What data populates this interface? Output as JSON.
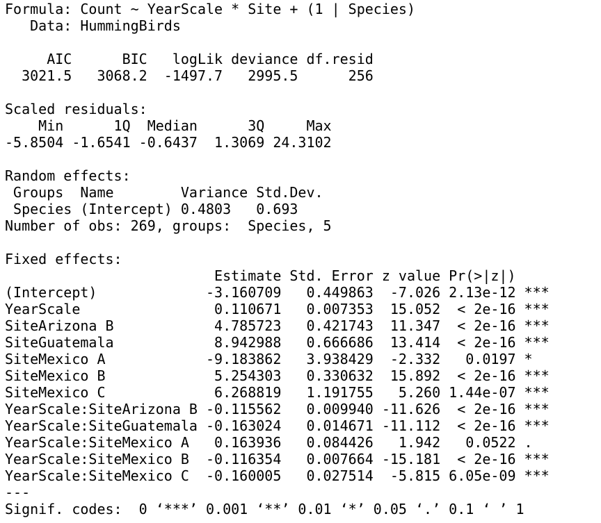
{
  "output": {
    "lines": [
      "Formula: Count ~ YearScale * Site + (1 | Species)",
      "   Data: HummingBirds",
      "",
      "     AIC      BIC   logLik deviance df.resid",
      "  3021.5   3068.2  -1497.7   2995.5      256",
      "",
      "Scaled residuals:",
      "    Min      1Q  Median      3Q     Max",
      "-5.8504 -1.6541 -0.6437  1.3069 24.3102",
      "",
      "Random effects:",
      " Groups  Name        Variance Std.Dev.",
      " Species (Intercept) 0.4803   0.693",
      "Number of obs: 269, groups:  Species, 5",
      "",
      "Fixed effects:",
      "                         Estimate Std. Error z value Pr(>|z|)",
      "(Intercept)             -3.160709   0.449863  -7.026 2.13e-12 ***",
      "YearScale                0.110671   0.007353  15.052  < 2e-16 ***",
      "SiteArizona B            4.785723   0.421743  11.347  < 2e-16 ***",
      "SiteGuatemala            8.942988   0.666686  13.414  < 2e-16 ***",
      "SiteMexico A            -9.183862   3.938429  -2.332   0.0197 *",
      "SiteMexico B             5.254303   0.330632  15.892  < 2e-16 ***",
      "SiteMexico C             6.268819   1.191755   5.260 1.44e-07 ***",
      "YearScale:SiteArizona B -0.115562   0.009940 -11.626  < 2e-16 ***",
      "YearScale:SiteGuatemala -0.163024   0.014671 -11.112  < 2e-16 ***",
      "YearScale:SiteMexico A   0.163936   0.084426   1.942   0.0522 .",
      "YearScale:SiteMexico B  -0.116354   0.007664 -15.181  < 2e-16 ***",
      "YearScale:SiteMexico C  -0.160005   0.027514  -5.815 6.05e-09 ***",
      "---",
      "Signif. codes:  0 ‘***’ 0.001 ‘**’ 0.01 ‘*’ 0.05 ‘.’ 0.1 ‘ ’ 1"
    ]
  }
}
